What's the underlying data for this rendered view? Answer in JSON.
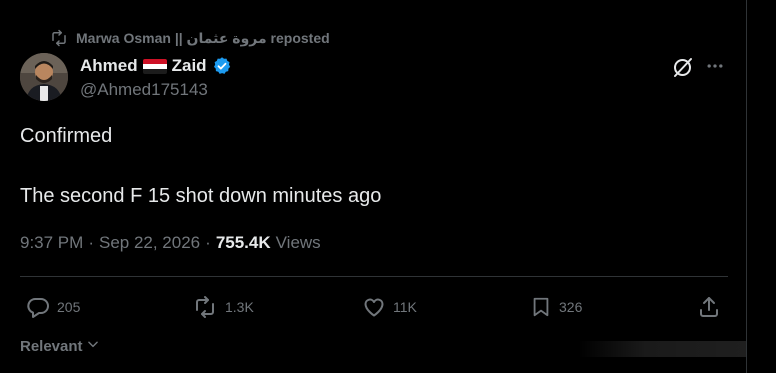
{
  "colors": {
    "background": "#000000",
    "primary_text": "#e7e9ea",
    "secondary_text": "#71767b",
    "verified_blue": "#1d9bf0",
    "divider": "#2f3336"
  },
  "repost_banner": {
    "icon": "repost-icon",
    "text": "Marwa Osman || مروة عثمان reposted"
  },
  "author": {
    "avatar": "avatar-photo",
    "name_part1": "Ahmed",
    "flag": "egypt-flag",
    "name_part2": "Zaid",
    "verified_icon": "verified-badge-icon",
    "handle": "@Ahmed175143"
  },
  "header_actions": {
    "grok_icon": "grok-icon",
    "more_icon": "more-icon"
  },
  "tweet": {
    "line1": "Confirmed",
    "line2": "The second F 15 shot down minutes ago"
  },
  "meta": {
    "time": "9:37 PM",
    "separator": "·",
    "date": "Sep 22, 2026",
    "views_count": "755.4K",
    "views_label": "Views"
  },
  "actions": {
    "reply": {
      "icon": "reply-icon",
      "count": "205"
    },
    "repost": {
      "icon": "repost-icon",
      "count": "1.3K"
    },
    "like": {
      "icon": "heart-icon",
      "count": "11K"
    },
    "bookmark": {
      "icon": "bookmark-icon",
      "count": "326"
    },
    "share": {
      "icon": "share-icon"
    }
  },
  "sort": {
    "label": "Relevant",
    "icon": "chevron-down-icon"
  }
}
